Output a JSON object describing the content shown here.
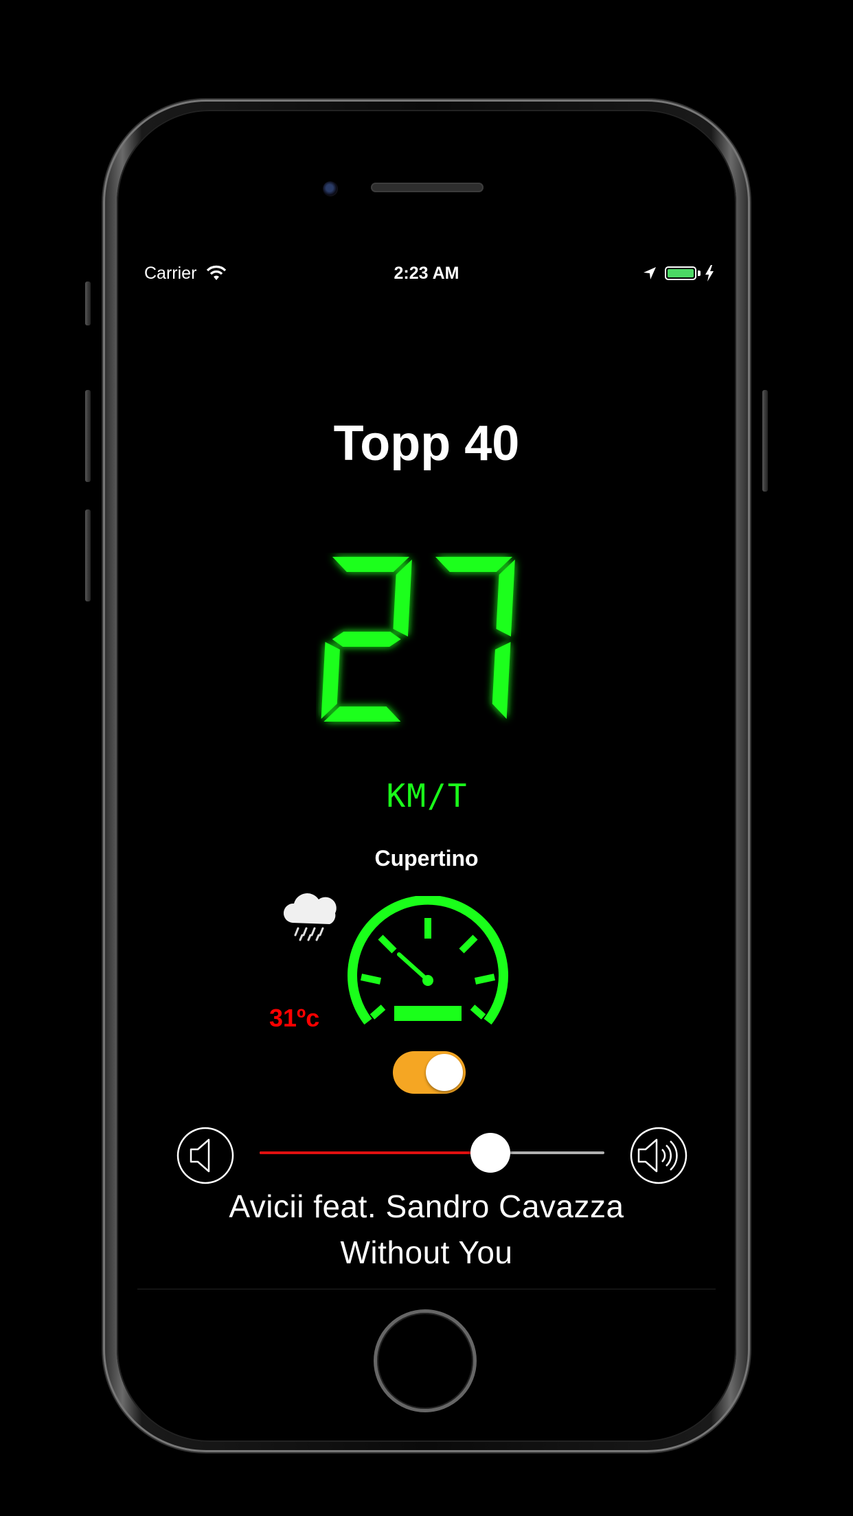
{
  "status_bar": {
    "carrier": "Carrier",
    "time": "2:23 AM",
    "battery_level": 1.0
  },
  "header": {
    "title": "Topp 40"
  },
  "speedometer": {
    "speed": "27",
    "unit": "KM/T",
    "color": "#1aff1a"
  },
  "weather": {
    "city": "Cupertino",
    "temperature": "31ºc",
    "icon": "cloud-rain-icon"
  },
  "toggle": {
    "on": true,
    "color": "#f5a623"
  },
  "volume": {
    "level": 0.67,
    "fill_color": "#e01010"
  },
  "now_playing": {
    "artist": "Avicii feat. Sandro Cavazza",
    "song": "Without You"
  }
}
